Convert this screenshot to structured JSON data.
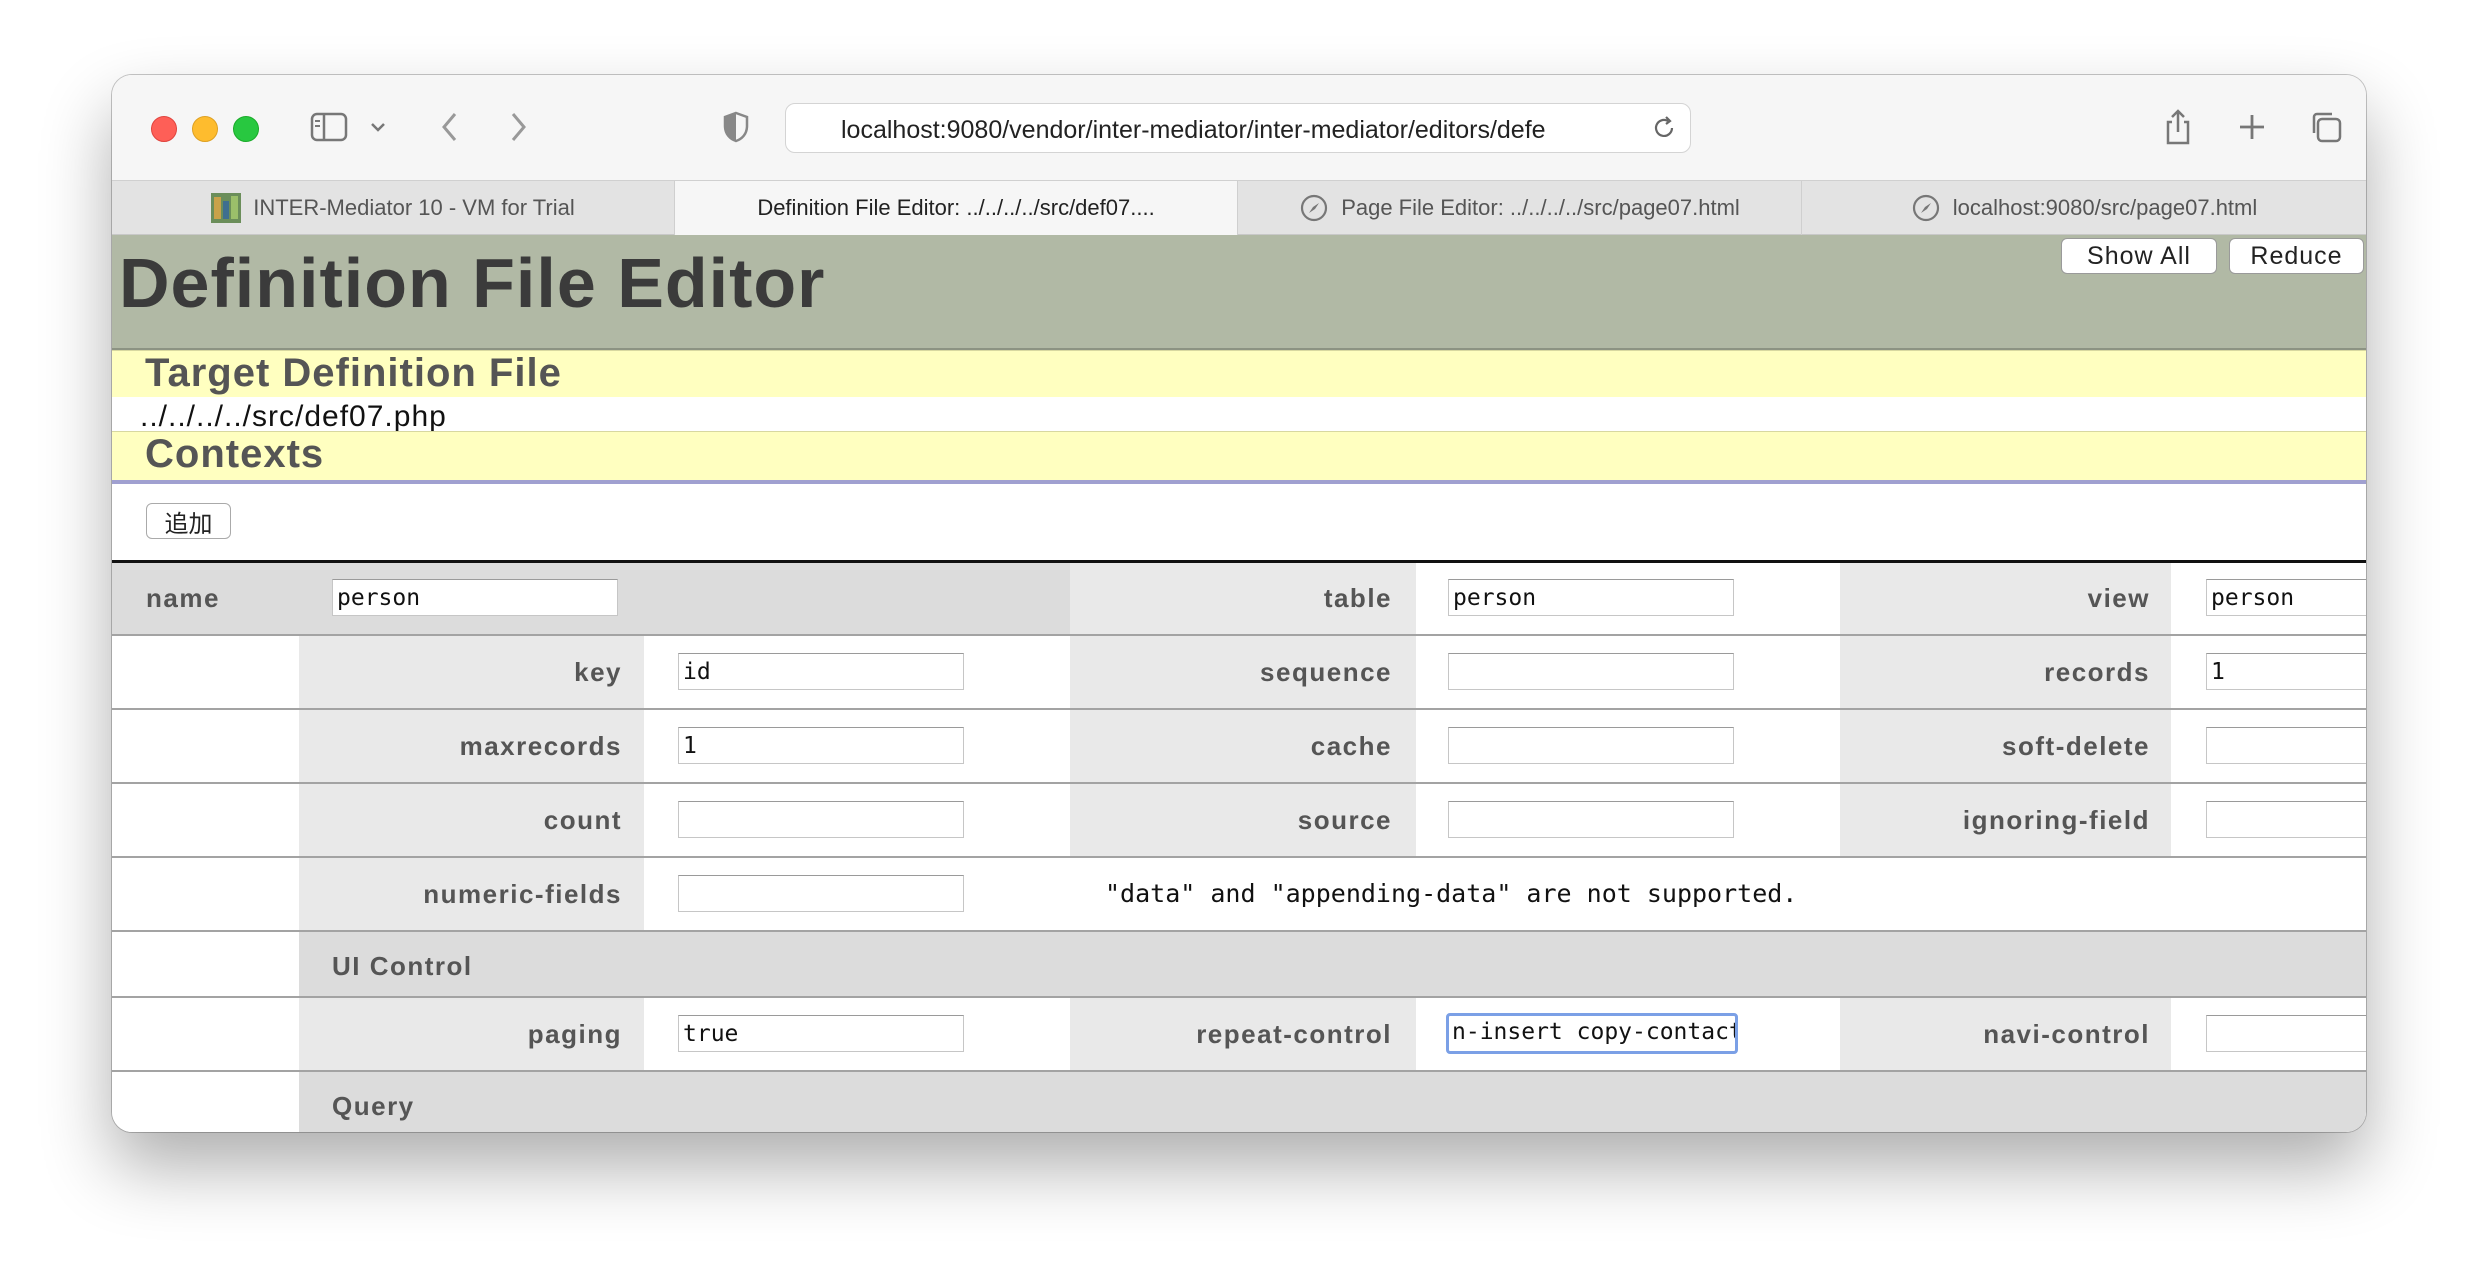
{
  "browser": {
    "url": "localhost:9080/vendor/inter-mediator/inter-mediator/editors/defe",
    "tabs": [
      {
        "label": "INTER-Mediator 10 - VM for Trial",
        "icon": "inter-mediator-favicon-icon",
        "active": false
      },
      {
        "label": "Definition File Editor: ../../../../src/def07....",
        "icon": "",
        "active": true
      },
      {
        "label": "Page File Editor: ../../../../src/page07.html",
        "icon": "compass-icon",
        "active": false
      },
      {
        "label": "localhost:9080/src/page07.html",
        "icon": "compass-icon",
        "active": false
      }
    ]
  },
  "page": {
    "title": "Definition File Editor",
    "show_all_label": "Show All",
    "reduce_label": "Reduce",
    "target_section": "Target Definition File",
    "file_path": "../../../../src/def07.php",
    "contexts_section": "Contexts",
    "add_label": "追加"
  },
  "context": {
    "name_label": "name",
    "name_value": "person",
    "table_label": "table",
    "table_value": "person",
    "view_label": "view",
    "view_value": "person",
    "key_label": "key",
    "key_value": "id",
    "sequence_label": "sequence",
    "sequence_value": "",
    "records_label": "records",
    "records_value": "1",
    "maxrecords_label": "maxrecords",
    "maxrecords_value": "1",
    "cache_label": "cache",
    "cache_value": "",
    "soft_delete_label": "soft-delete",
    "soft_delete_value": "",
    "count_label": "count",
    "count_value": "",
    "source_label": "source",
    "source_value": "",
    "ignoring_field_label": "ignoring-field",
    "ignoring_field_value": "",
    "numeric_fields_label": "numeric-fields",
    "numeric_fields_value": "",
    "data_note": "\"data\" and \"appending-data\" are not supported.",
    "ui_control_section": "UI Control",
    "paging_label": "paging",
    "paging_value": "true",
    "repeat_control_label": "repeat-control",
    "repeat_control_value": "n-insert copy-contact",
    "navi_control_label": "navi-control",
    "navi_control_value": "",
    "query_section": "Query"
  },
  "colors": {
    "header_bg": "#b1b9a5",
    "band_bg": "#ffffc0",
    "label_cell_bg": "#e9e9e9",
    "focus_ring": "#7ba0e6"
  }
}
